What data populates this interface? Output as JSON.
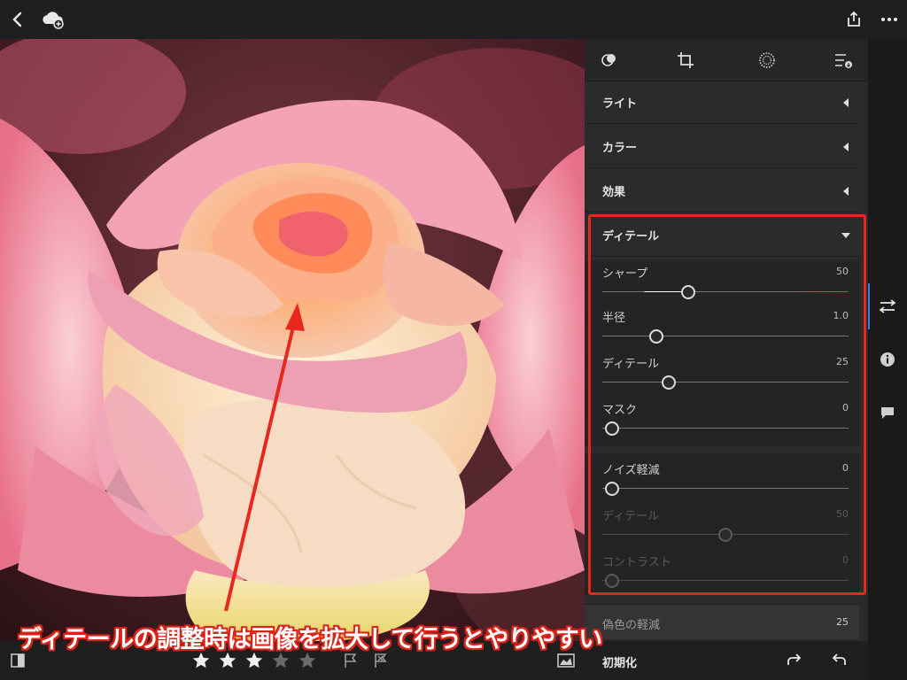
{
  "topbar": {
    "back": "back-icon",
    "cloud": "cloud-add-icon",
    "share": "share-icon",
    "more": "more-icon"
  },
  "panel": {
    "tools": [
      "filter-icon",
      "crop-icon",
      "brush-icon",
      "presets-icon"
    ],
    "sections": [
      {
        "label": "ライト",
        "state": "collapsed"
      },
      {
        "label": "カラー",
        "state": "collapsed"
      },
      {
        "label": "効果",
        "state": "collapsed"
      },
      {
        "label": "ディテール",
        "state": "expanded"
      }
    ],
    "sliders": [
      {
        "label": "シャープ",
        "value": "50",
        "level": 0.35,
        "enabled": true
      },
      {
        "label": "半径",
        "value": "1.0",
        "level": 0.22,
        "enabled": true
      },
      {
        "label": "ディテール",
        "value": "25",
        "level": 0.27,
        "enabled": true
      },
      {
        "label": "マスク",
        "value": "0",
        "level": 0.04,
        "enabled": true
      },
      {
        "label": "ノイズ軽減",
        "value": "0",
        "level": 0.04,
        "enabled": true
      },
      {
        "label": "ディテール",
        "value": "50",
        "level": 0.5,
        "enabled": false
      },
      {
        "label": "コントラスト",
        "value": "0",
        "level": 0.04,
        "enabled": false
      }
    ],
    "false_color": {
      "label": "偽色の軽減",
      "value": "25"
    },
    "footer": {
      "reset": "初期化",
      "redo": "redo-icon",
      "undo": "undo-icon"
    }
  },
  "rightbar": [
    "adjust-icon",
    "info-icon",
    "comment-icon"
  ],
  "bottombar": {
    "rating": 3,
    "max_rating": 5
  },
  "annotation": "ディテールの調整時は画像を拡大して行うとやりやすい",
  "colors": {
    "accent": "#3d7be0",
    "highlight": "#e8271d",
    "panel": "#2b2b2b"
  }
}
